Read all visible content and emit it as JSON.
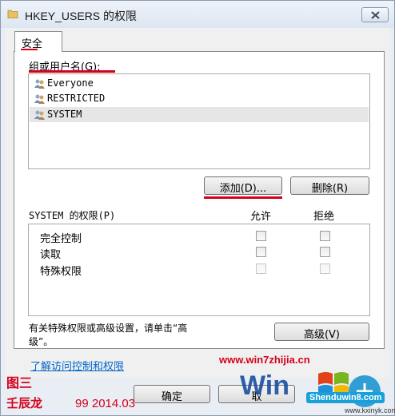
{
  "window": {
    "title": "HKEY_USERS 的权限"
  },
  "tab": {
    "label": "安全"
  },
  "groups": {
    "label": "组或用户名(G):",
    "items": [
      {
        "label": "Everyone",
        "selected": false
      },
      {
        "label": "RESTRICTED",
        "selected": false
      },
      {
        "label": "SYSTEM",
        "selected": true
      }
    ]
  },
  "buttons": {
    "add": "添加(D)...",
    "remove": "删除(R)",
    "advanced": "高级(V)",
    "ok": "确定",
    "cancel": "取"
  },
  "permissions": {
    "label": "SYSTEM 的权限(P)",
    "allow_header": "允许",
    "deny_header": "拒绝",
    "rows": [
      {
        "name": "完全控制",
        "allow": false,
        "deny": false,
        "disabled": false
      },
      {
        "name": "读取",
        "allow": false,
        "deny": false,
        "disabled": false
      },
      {
        "name": "特殊权限",
        "allow": false,
        "deny": false,
        "disabled": true
      }
    ]
  },
  "advanced_note": {
    "line1": "有关特殊权限或高级设置，请单击“高",
    "line2": "级”。"
  },
  "link": {
    "text": "了解访问控制和权限"
  },
  "overlays": {
    "site": "www.win7zhijia.cn",
    "figure_label": "图三",
    "signature": "壬辰龙",
    "signature_date": "99 2014.03",
    "shenduwin": "Shenduwin8.com",
    "kxinyk": "www.kxinyk.com"
  },
  "colors": {
    "annotation_red": "#d6001c",
    "link_blue": "#0066cc",
    "accent_blue": "#1aa0d8"
  },
  "icons": {
    "title": "folder-icon",
    "close": "close-icon",
    "user": "users-icon"
  }
}
